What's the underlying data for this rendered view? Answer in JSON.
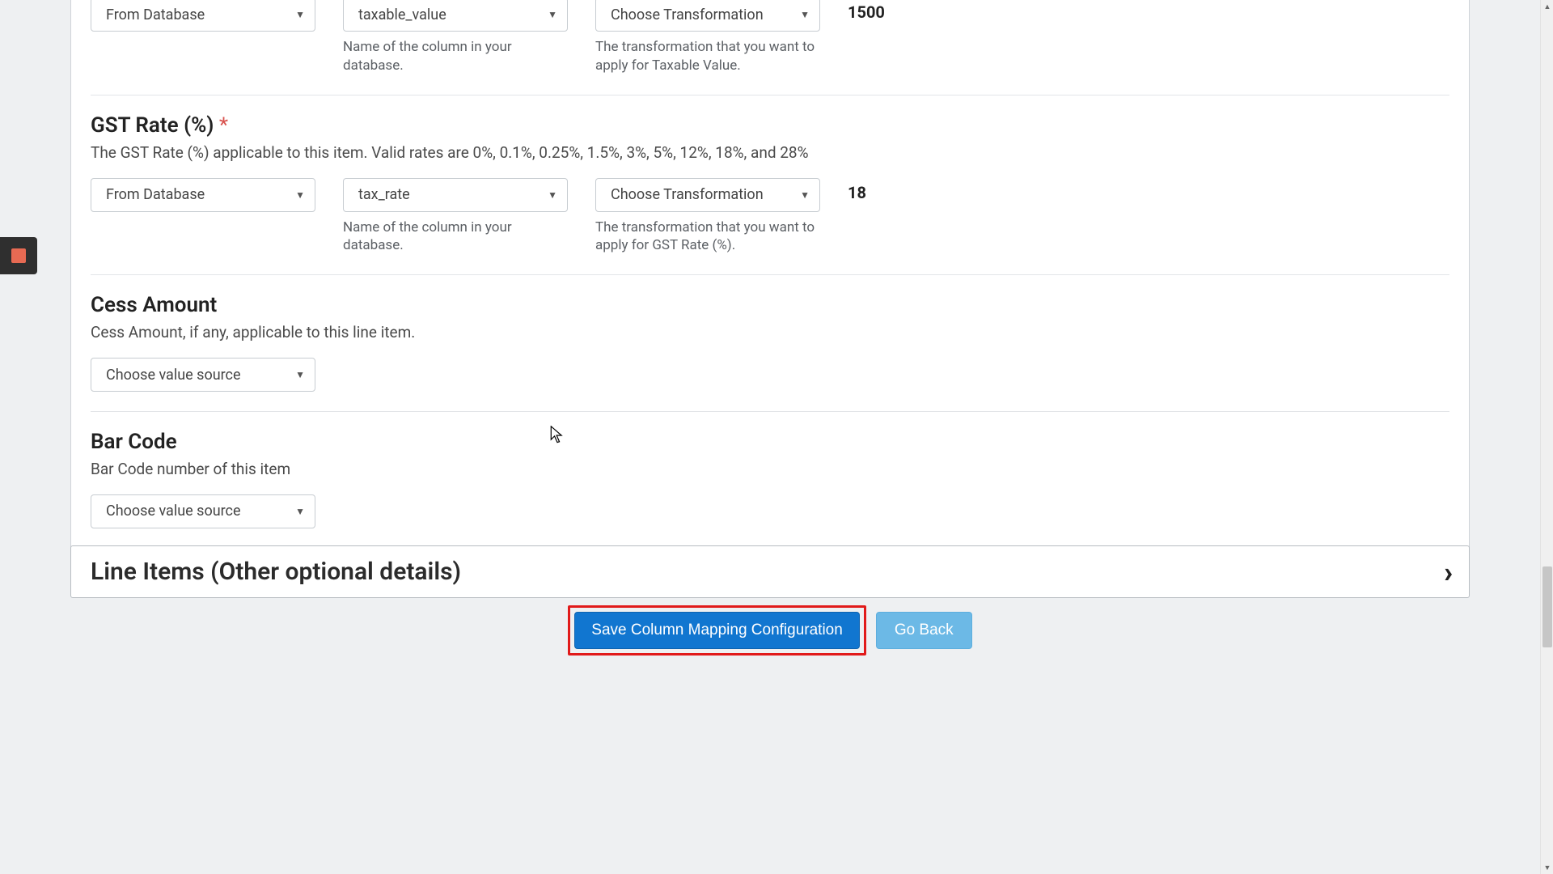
{
  "fields": {
    "taxable_value": {
      "source_select": "From Database",
      "column_select": "taxable_value",
      "column_helper": "Name of the column in your database.",
      "transform_select": "Choose Transformation",
      "transform_helper": "The transformation that you want to apply for Taxable Value.",
      "preview": "1500"
    },
    "gst_rate": {
      "title": "GST Rate (%)",
      "required_marker": "*",
      "description": "The GST Rate (%) applicable to this item. Valid rates are 0%, 0.1%, 0.25%, 1.5%, 3%, 5%, 12%, 18%, and 28%",
      "source_select": "From Database",
      "column_select": "tax_rate",
      "column_helper": "Name of the column in your database.",
      "transform_select": "Choose Transformation",
      "transform_helper": "The transformation that you want to apply for GST Rate (%).",
      "preview": "18"
    },
    "cess_amount": {
      "title": "Cess Amount",
      "description": "Cess Amount, if any, applicable to this line item.",
      "source_select": "Choose value source"
    },
    "bar_code": {
      "title": "Bar Code",
      "description": "Bar Code number of this item",
      "source_select": "Choose value source"
    }
  },
  "accordion": {
    "title": "Line Items (Other optional details)"
  },
  "buttons": {
    "save": "Save Column Mapping Configuration",
    "back": "Go Back"
  }
}
